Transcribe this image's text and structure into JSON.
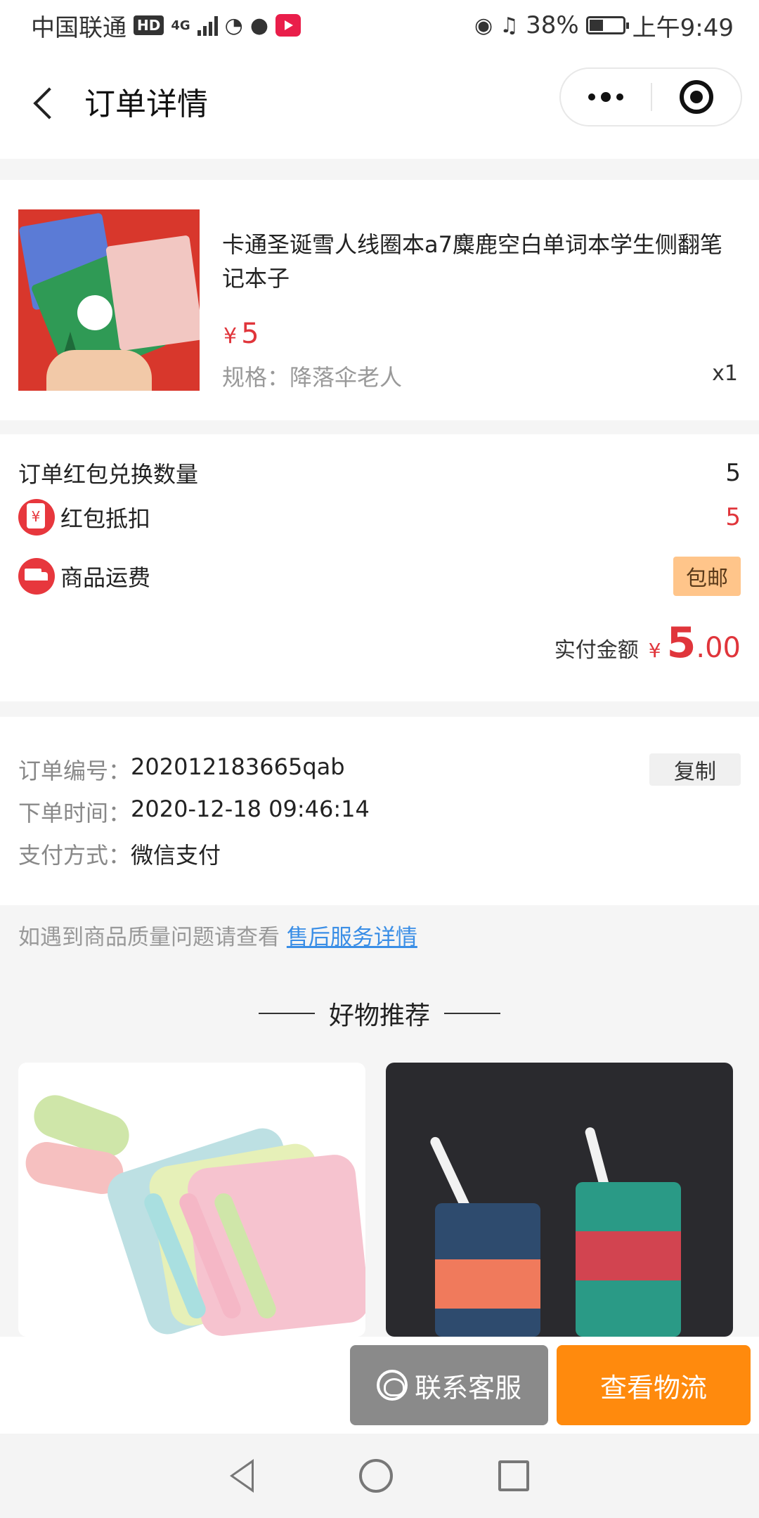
{
  "status_bar": {
    "carrier": "中国联通",
    "hd": "HD",
    "network": "4G",
    "battery": "38%",
    "time": "上午9:49"
  },
  "nav": {
    "title": "订单详情",
    "back_icon": "chevron-left-icon",
    "more_icon": "more-dots-icon",
    "close_icon": "target-close-icon"
  },
  "product": {
    "title": "卡通圣诞雪人线圈本a7麋鹿空白单词本学生侧翻笔记本子",
    "currency": "¥",
    "price": "5",
    "spec": "规格：降落伞老人",
    "qty": "x1"
  },
  "summary": {
    "exchange_label": "订单红包兑换数量",
    "exchange_value": "5",
    "deduct_label": "红包抵扣",
    "deduct_value": "5",
    "shipping_label": "商品运费",
    "shipping_tag": "包邮",
    "paid_label": "实付金额",
    "paid_currency": "¥",
    "paid_int": "5",
    "paid_dec": ".00"
  },
  "order_info": {
    "number_label": "订单编号：",
    "number_value": "202012183665qab",
    "copy_button": "复制",
    "time_label": "下单时间：",
    "time_value": "2020-12-18 09:46:14",
    "pay_label": "支付方式：",
    "pay_value": "微信支付"
  },
  "notice": {
    "text": "如遇到商品质量问题请查看",
    "link": "售后服务详情"
  },
  "recommend": {
    "title": "好物推荐"
  },
  "actions": {
    "service_label": "联系客服",
    "track_label": "查看物流"
  },
  "colors": {
    "accent_red": "#e0353b",
    "orange": "#ff8a0d",
    "tag_bg": "#ffc58a",
    "link_blue": "#3a8ee6"
  }
}
